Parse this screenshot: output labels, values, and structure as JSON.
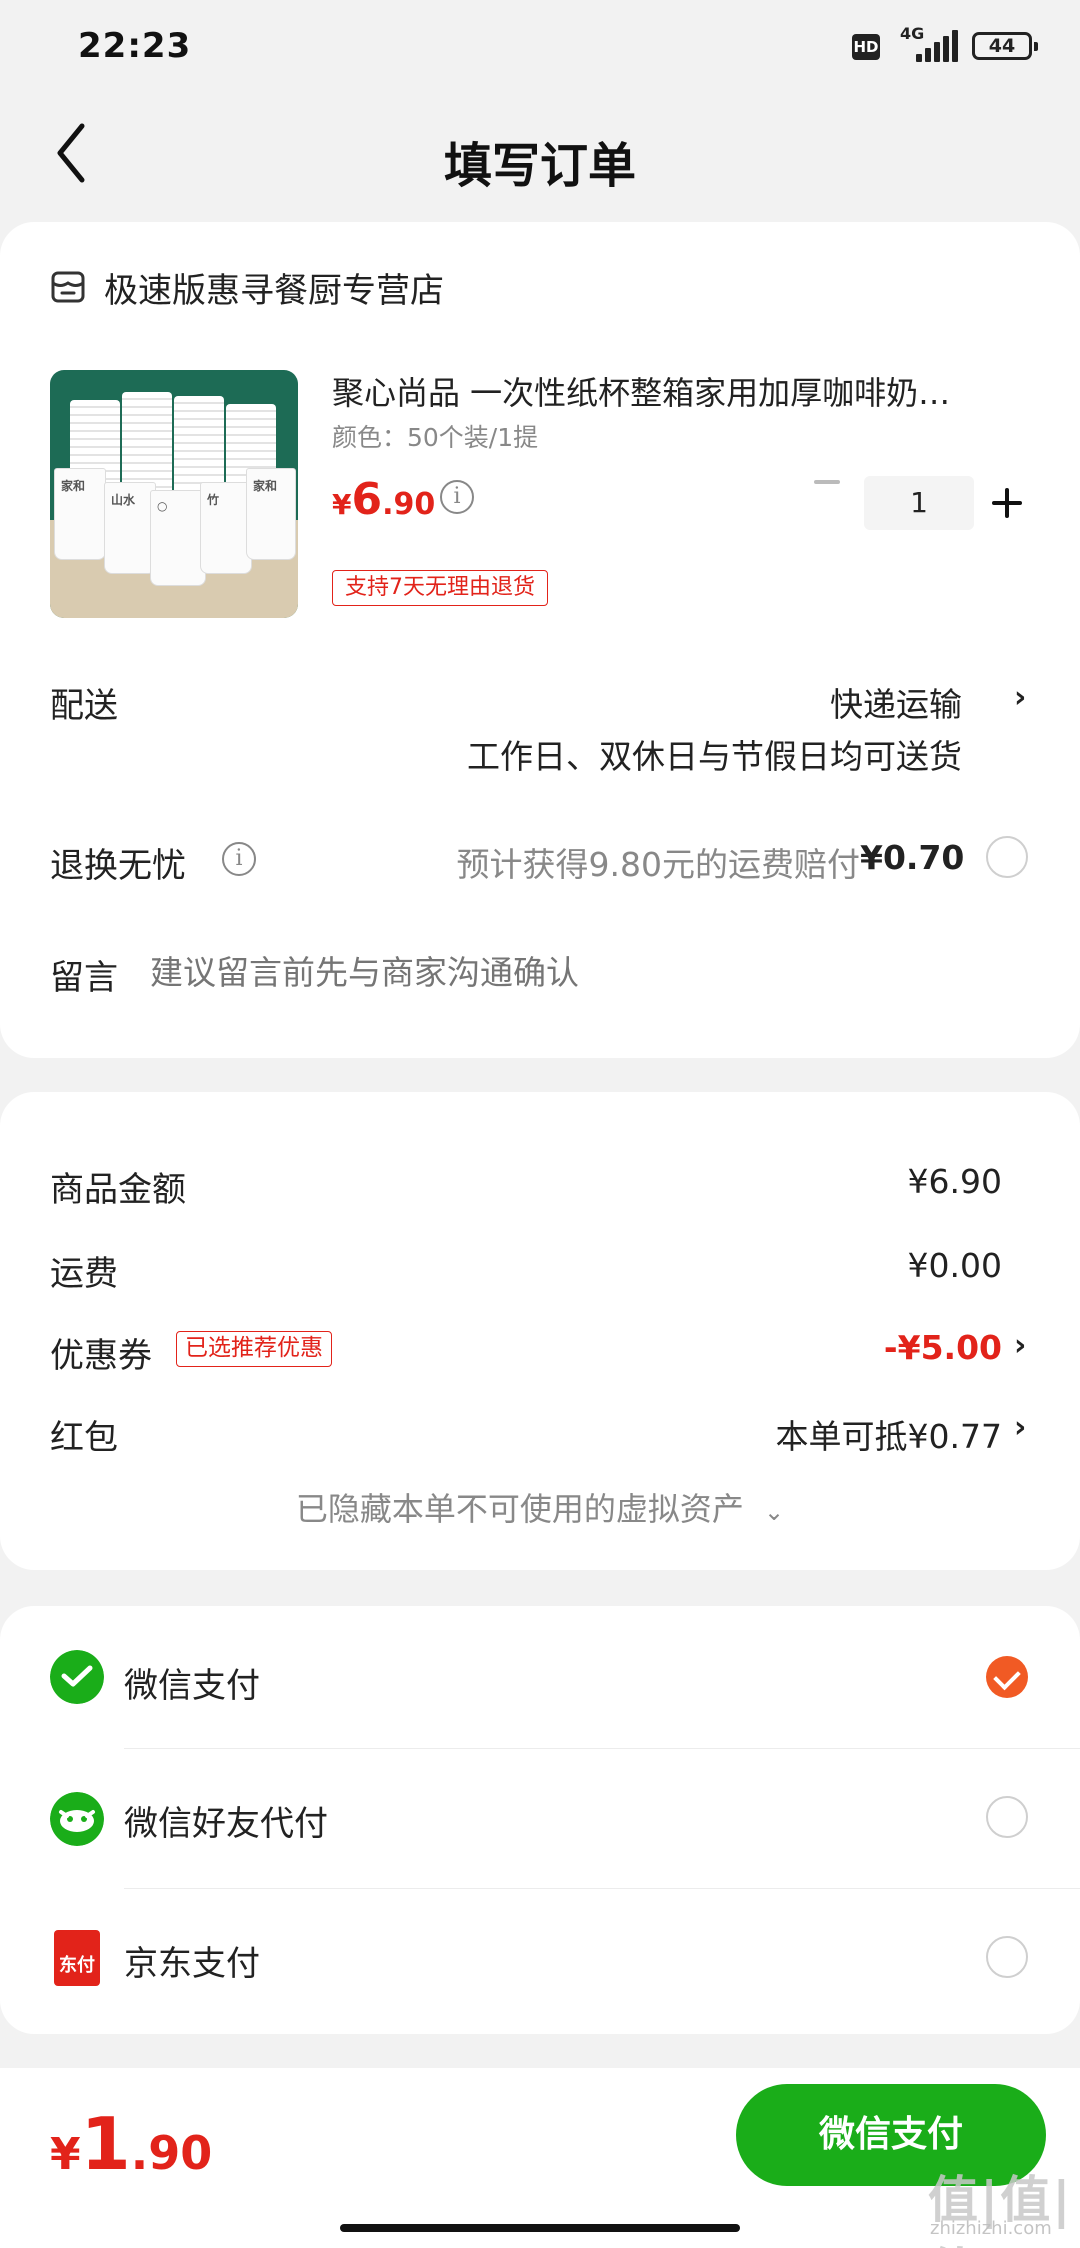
{
  "status_bar": {
    "time": "22:23",
    "hd": "HD",
    "network": "4G",
    "battery": "44"
  },
  "nav": {
    "title": "填写订单"
  },
  "store": {
    "name": "极速版惠寻餐厨专营店"
  },
  "product": {
    "title": "聚心尚品 一次性纸杯整箱家用加厚咖啡奶…",
    "spec": "颜色：50个装/1提",
    "price_symbol": "¥",
    "price_int": "6",
    "price_dec": ".90",
    "quantity": "1",
    "return_badge": "支持7天无理由退货"
  },
  "delivery": {
    "label": "配送",
    "method": "快递运输",
    "note": "工作日、双休日与节假日均可送货"
  },
  "return_worry": {
    "label": "退换无忧",
    "desc": "预计获得9.80元的运费赔付",
    "price": "¥0.70"
  },
  "message": {
    "label": "留言",
    "placeholder": "建议留言前先与商家沟通确认"
  },
  "summary": {
    "goods_label": "商品金额",
    "goods_value": "¥6.90",
    "shipping_label": "运费",
    "shipping_value": "¥0.00",
    "coupon_label": "优惠券",
    "coupon_badge": "已选推荐优惠",
    "coupon_value": "-¥5.00",
    "redpacket_label": "红包",
    "redpacket_value": "本单可抵¥0.77",
    "hidden_assets": "已隐藏本单不可使用的虚拟资产"
  },
  "payment_methods": [
    {
      "label": "微信支付",
      "selected": true
    },
    {
      "label": "微信好友代付",
      "selected": false
    },
    {
      "label": "京东支付",
      "selected": false,
      "icon_text": "东付"
    }
  ],
  "bottom": {
    "total_symbol": "¥",
    "total_int": "1",
    "total_dec": ".90",
    "pay_button": "微信支付",
    "watermark": "值|值|值",
    "watermark_url": "zhizhizhi.com"
  },
  "colors": {
    "accent_red": "#e2231a",
    "wechat_green": "#1aad19",
    "check_orange": "#f15a24"
  }
}
